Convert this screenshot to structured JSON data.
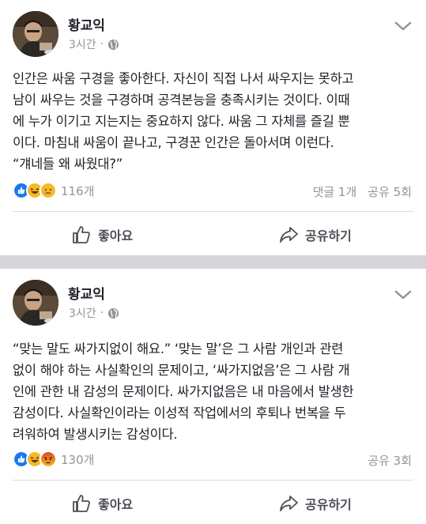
{
  "posts": [
    {
      "author": "황교익",
      "time": "3시간",
      "privacy_icon": "globe-icon",
      "text": "인간은 싸움 구경을 좋아한다. 자신이 직접 나서 싸우지는 못하고\n남이 싸우는 것을 구경하며 공격본능을 충족시키는 것이다. 이때\n에 누가 이기고 지는지는 중요하지 않다. 싸움 그 자체를 즐길 뿐\n이다. 마침내 싸움이 끝나고, 구경꾼 인간은 돌아서며 이런다.\n“걔네들 왜 싸웠대?”",
      "reactions": [
        "like",
        "haha",
        "sad"
      ],
      "reaction_count": "116개",
      "comments": "댓글 1개",
      "shares": "공유 5회",
      "like_label": "좋아요",
      "share_label": "공유하기"
    },
    {
      "author": "황교익",
      "time": "3시간",
      "privacy_icon": "globe-icon",
      "text": "“맞는 말도 싸가지없이 해요.” ‘맞는 말’은 그 사람 개인과 관련\n없이 해야 하는 사실확인의 문제이고, ‘싸가지없음’은 그 사람 개\n인에 관한 내 감성의 문제이다. 싸가지없음은 내 마음에서 발생한\n감성이다. 사실확인이라는 이성적 작업에서의 후퇴나 번복을 두\n려워하여 발생시키는 감성이다.",
      "reactions": [
        "like",
        "haha",
        "angry"
      ],
      "reaction_count": "130개",
      "comments": "",
      "shares": "공유 3회",
      "like_label": "좋아요",
      "share_label": "공유하기"
    }
  ],
  "colors": {
    "like": "#1877f2",
    "haha": "#f7b928",
    "sad": "#f7b928",
    "angry": "#e9710f",
    "divider": "#d4d6da"
  }
}
